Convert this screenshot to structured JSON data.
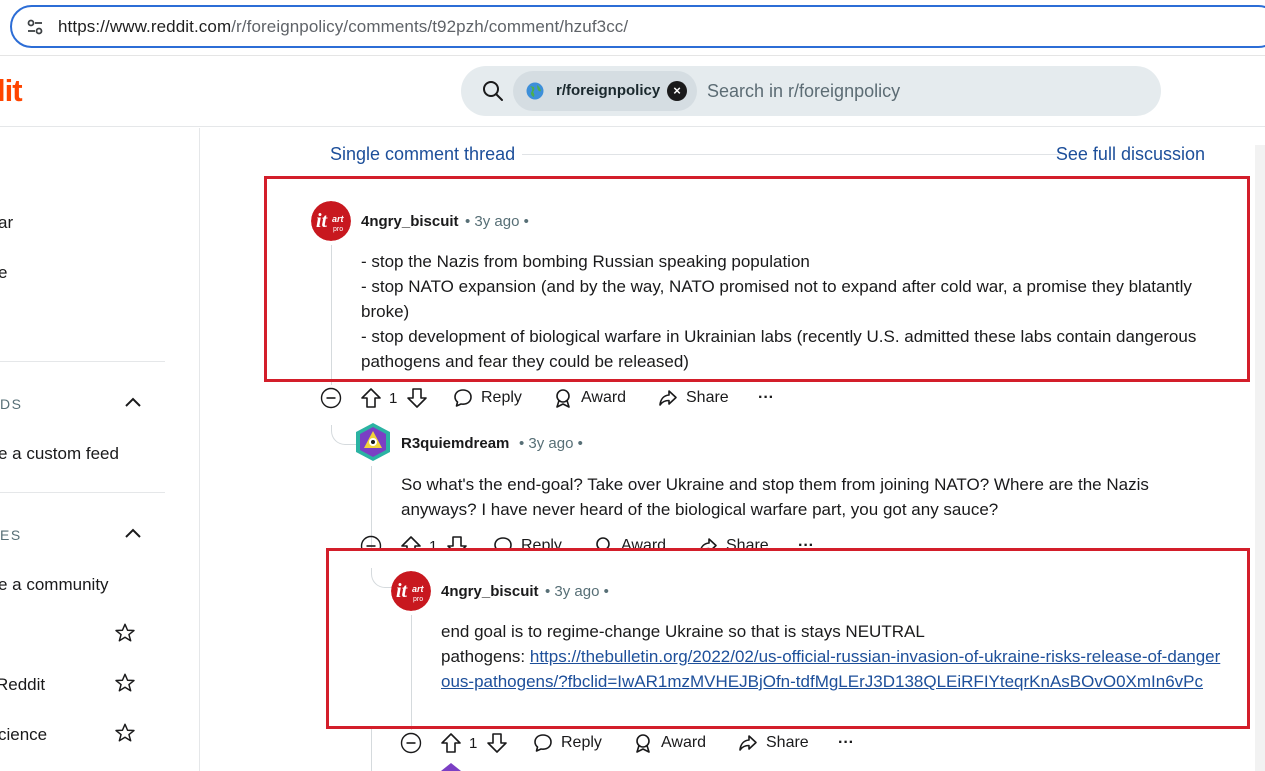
{
  "browser": {
    "url_host": "https://www.reddit.com",
    "url_path": "/r/foreignpolicy/comments/t92pzh/comment/hzuf3cc/"
  },
  "header": {
    "logo_fragment": "lit",
    "search_chip_label": "r/foreignpolicy",
    "search_placeholder": "Search in r/foreignpolicy"
  },
  "sidebar": {
    "item1": "ar",
    "item2": "e",
    "section1_header": "DS",
    "section1_item": "e a custom feed",
    "section2_header": "ES",
    "section2_item": "e a community",
    "community1": "Reddit",
    "community2": "cience"
  },
  "thread": {
    "single_label": "Single comment thread",
    "full_label": "See full discussion"
  },
  "comments": [
    {
      "author": "4ngry_biscuit",
      "meta": "• 3y ago •",
      "lines": [
        "- stop the Nazis from bombing Russian speaking population",
        "- stop NATO expansion (and by the way, NATO promised not to expand after cold war, a promise they blatantly broke)",
        "- stop development of biological warfare in Ukrainian labs (recently U.S. admitted these labs contain dangerous pathogens and fear they could be released)"
      ],
      "votes": "1",
      "reply": "Reply",
      "award": "Award",
      "share": "Share",
      "more": "···"
    },
    {
      "author": "R3quiemdream",
      "meta": "• 3y ago •",
      "text": "So what's the end-goal? Take over Ukraine and stop them from joining NATO? Where are the Nazis anyways? I have never heard of the biological warfare part, you got any sauce?",
      "votes": "1",
      "reply": "Reply",
      "award": "Award",
      "share": "Share",
      "more": "···"
    },
    {
      "author": "4ngry_biscuit",
      "meta": "• 3y ago •",
      "line1": "end goal is to regime-change Ukraine so that is stays NEUTRAL",
      "line2_prefix": "pathogens: ",
      "link": "https://thebulletin.org/2022/02/us-official-russian-invasion-of-ukraine-risks-release-of-dangerous-pathogens/?fbclid=IwAR1mzMVHEJBjOfn-tdfMgLErJ3D138QLEiRFIYteqrKnAsBOvO0XmIn6vPc",
      "votes": "1",
      "reply": "Reply",
      "award": "Award",
      "share": "Share",
      "more": "···"
    }
  ],
  "colors": {
    "reddit_orange": "#ff4500",
    "link_blue": "#1d4f9a",
    "highlight_red": "#d31e2a",
    "url_border": "#2c6dd6"
  }
}
